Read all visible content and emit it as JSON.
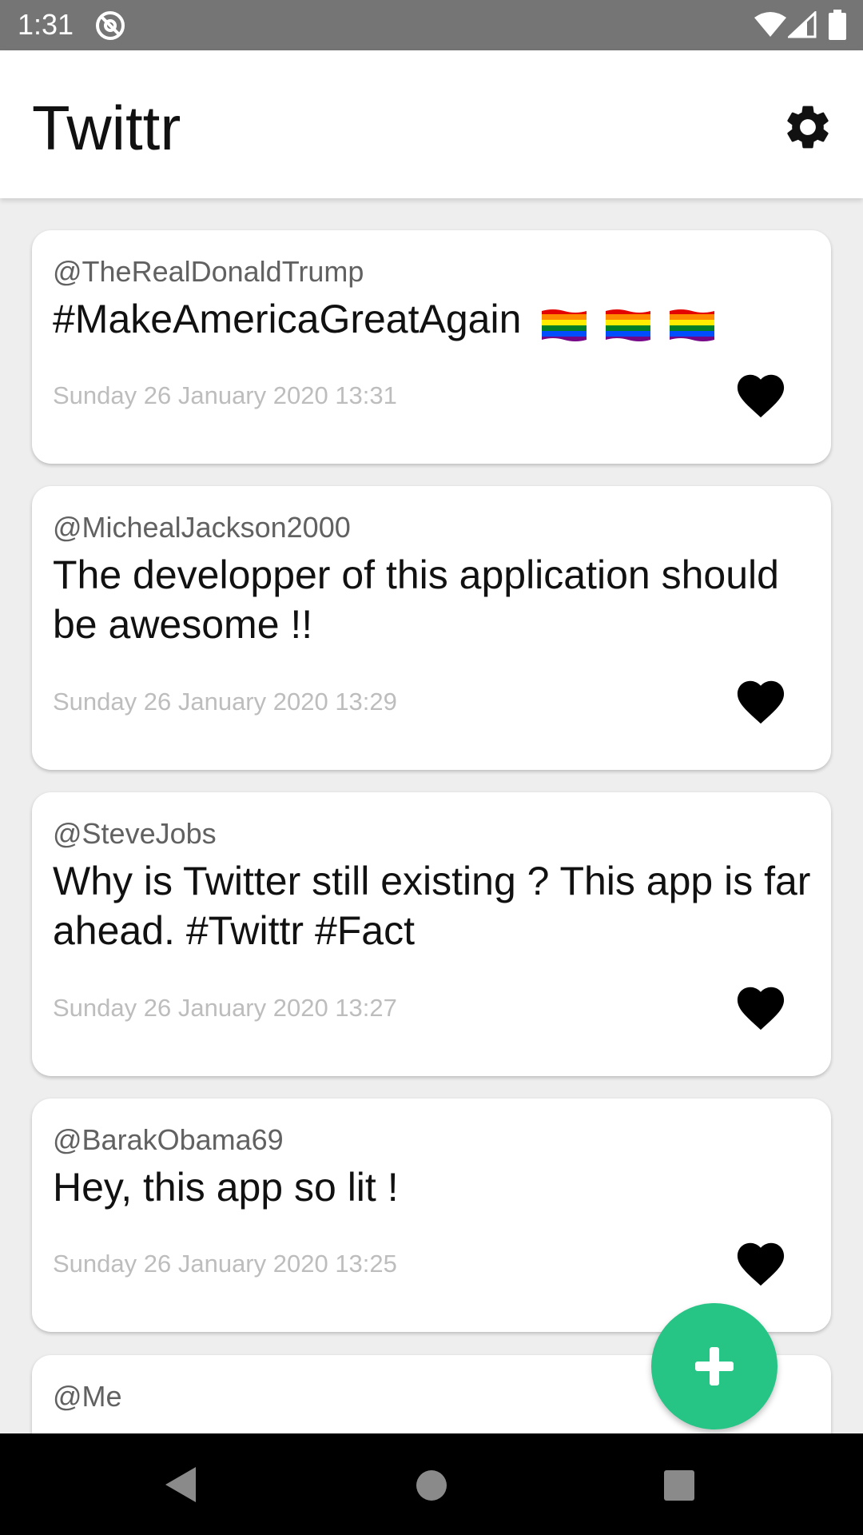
{
  "status_bar": {
    "time": "1:31",
    "icons": [
      "notification-icon",
      "wifi-icon",
      "signal-icon",
      "battery-icon"
    ]
  },
  "app_bar": {
    "title": "Twittr",
    "settings_icon": "gear-icon"
  },
  "tweets": [
    {
      "handle": "@TheRealDonaldTrump",
      "text": "#MakeAmericaGreatAgain",
      "emoji": [
        "rainbow-flag",
        "rainbow-flag",
        "rainbow-flag"
      ],
      "timestamp": "Sunday 26 January 2020 13:31",
      "liked": true
    },
    {
      "handle": "@MichealJackson2000",
      "text": "The developper of this application should be awesome !!",
      "timestamp": "Sunday 26 January 2020 13:29",
      "liked": true
    },
    {
      "handle": "@SteveJobs",
      "text": "Why is Twitter still existing ? This app is far ahead. #Twittr #Fact",
      "timestamp": "Sunday 26 January 2020 13:27",
      "liked": true
    },
    {
      "handle": "@BarakObama69",
      "text": "Hey, this app so lit !",
      "timestamp": "Sunday 26 January 2020 13:25",
      "liked": true
    },
    {
      "handle": "@Me"
    }
  ],
  "fab": {
    "icon": "plus-icon"
  },
  "nav_bar": {
    "icons": [
      "back-icon",
      "home-icon",
      "recents-icon"
    ]
  },
  "colors": {
    "status_bar": "#757575",
    "app_bar": "#FFFFFF",
    "background": "#EEEEEE",
    "fab": "#26C485",
    "handle": "#616161",
    "timestamp": "#BDBDBD",
    "text": "#111111",
    "nav_bar": "#000000"
  }
}
